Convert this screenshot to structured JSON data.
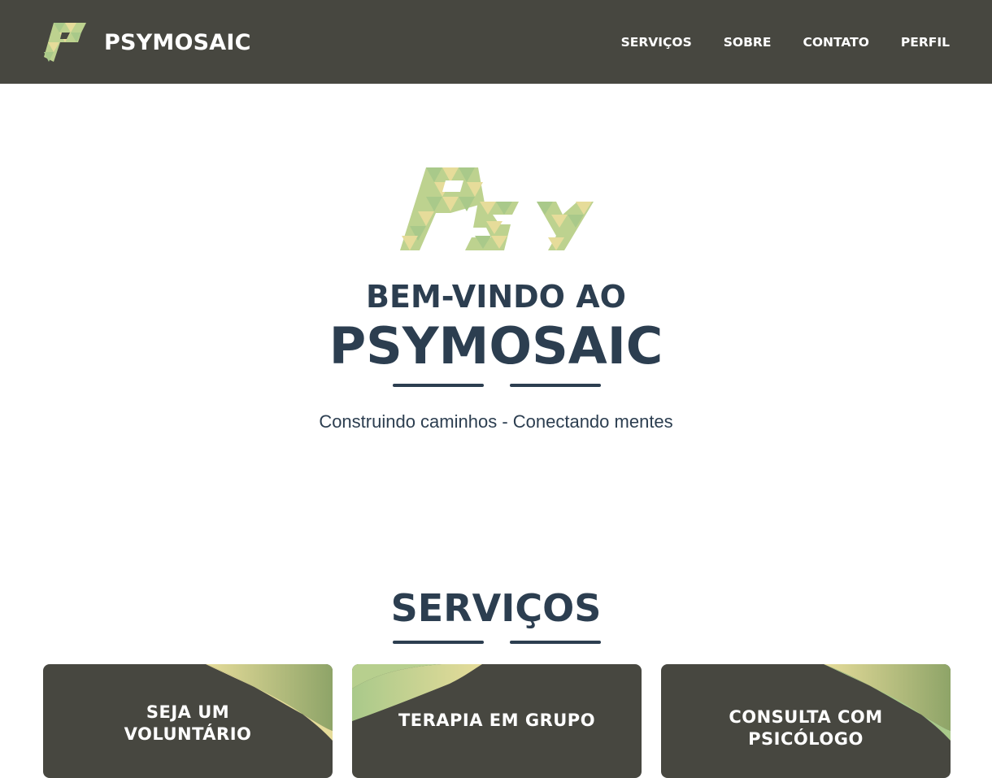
{
  "brand": {
    "logo_icon": "psymosaic-p-mosaic-logo",
    "name": "PSYMOSAIC"
  },
  "nav": {
    "items": [
      {
        "label": "SERVIÇOS"
      },
      {
        "label": "SOBRE"
      },
      {
        "label": "CONTATO"
      },
      {
        "label": "PERFIL"
      }
    ]
  },
  "hero": {
    "logo_icon": "psy-mosaic-logo",
    "welcome": "BEM-VINDO AO",
    "title": "PSYMOSAIC",
    "subtitle": "Construindo caminhos - Conectando mentes"
  },
  "services": {
    "title": "SERVIÇOS",
    "cards": [
      {
        "title_line1": "SEJA UM",
        "title_line2": "VOLUNTÁRIO"
      },
      {
        "title_line1": "TERAPIA EM GRUPO",
        "title_line2": ""
      },
      {
        "title_line1": "CONSULTA COM",
        "title_line2": "PSICÓLOGO"
      }
    ]
  },
  "colors": {
    "navbar_bg": "#474740",
    "text_dark": "#2c3e50",
    "mosaic_green": "#a9c98a",
    "mosaic_yellow": "#e6dc9a",
    "card_bg": "#474740"
  }
}
